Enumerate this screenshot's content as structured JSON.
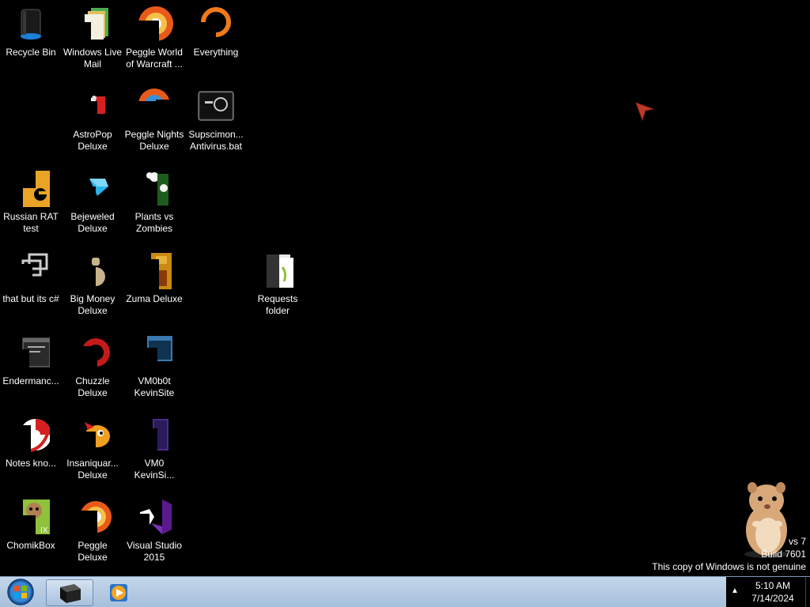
{
  "desktop_icons": [
    {
      "id": "recycle-bin",
      "label": "Recycle Bin",
      "icon": "recycle-bin-icon"
    },
    {
      "id": "windows-live-mail",
      "label": "Windows Live Mail",
      "icon": "mail-folder-icon"
    },
    {
      "id": "peggle-world-of-warcraft",
      "label": "Peggle World of Warcraft ...",
      "icon": "peggle-ball-icon"
    },
    {
      "id": "everything",
      "label": "Everything",
      "icon": "everything-search-icon"
    },
    {
      "id": "astropop-deluxe",
      "label": "AstroPop Deluxe",
      "icon": "astropop-icon"
    },
    {
      "id": "peggle-nights-deluxe",
      "label": "Peggle Nights Deluxe",
      "icon": "peggle-nights-icon"
    },
    {
      "id": "supscimon-antivirus",
      "label": "Supscimon... Antivirus.bat",
      "icon": "batch-file-icon"
    },
    {
      "id": "russian-rat",
      "label": "Russian RAT test",
      "icon": "orange-app-icon"
    },
    {
      "id": "bejeweled-deluxe",
      "label": "Bejeweled Deluxe",
      "icon": "blue-gem-icon"
    },
    {
      "id": "plants-vs-zombies",
      "label": "Plants vs Zombies",
      "icon": "flower-icon"
    },
    {
      "id": "that-but-its-csharp",
      "label": "that but its c#",
      "icon": "stacked-windows-icon"
    },
    {
      "id": "big-money-deluxe",
      "label": "Big Money Deluxe",
      "icon": "money-bag-icon"
    },
    {
      "id": "zuma-deluxe",
      "label": "Zuma Deluxe",
      "icon": "zuma-frog-icon"
    },
    {
      "id": "requests-folder",
      "label": "Requests folder",
      "icon": "folder-icon"
    },
    {
      "id": "endermanc",
      "label": "Endermanc...",
      "icon": "window-app-icon"
    },
    {
      "id": "chuzzle-deluxe",
      "label": "Chuzzle Deluxe",
      "icon": "chuzzle-icon"
    },
    {
      "id": "vm0b0t-kevinsite",
      "label": "VM0b0t KevinSite",
      "icon": "blue-window-icon"
    },
    {
      "id": "notes-kno",
      "label": "Notes kno...",
      "icon": "red-swirl-icon"
    },
    {
      "id": "insaniquarium-deluxe",
      "label": "Insaniquar... Deluxe",
      "icon": "fish-icon"
    },
    {
      "id": "vm0-kevinsite",
      "label": "VM0 KevinSi...",
      "icon": "purple-file-icon"
    },
    {
      "id": "chomikbox",
      "label": "ChomikBox",
      "icon": "hamster-box-icon"
    },
    {
      "id": "peggle-deluxe",
      "label": "Peggle Deluxe",
      "icon": "peggle-ball-icon"
    },
    {
      "id": "visual-studio-2015",
      "label": "Visual Studio 2015",
      "icon": "visual-studio-icon"
    }
  ],
  "watermark": {
    "line1": "vs 7",
    "line2": "Build 7601",
    "line3": "This copy of Windows is not genuine"
  },
  "taskbar": {
    "start_icon": "windows-orb-icon",
    "pinned": [
      {
        "id": "explorer",
        "icon": "black-box-icon"
      },
      {
        "id": "media-player",
        "icon": "media-player-icon"
      }
    ],
    "clock_time": "5:10 AM",
    "clock_date": "7/14/2024"
  },
  "colors": {
    "desktop_background": "#000000",
    "taskbar": "#b5cbe3",
    "tray": "#000000"
  }
}
